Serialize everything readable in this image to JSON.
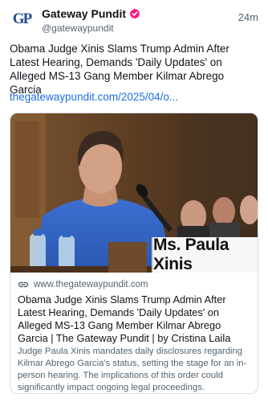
{
  "account": {
    "avatar_label": "GP",
    "display_name": "Gateway Pundit",
    "handle": "@gatewaypundit",
    "verified_icon": "verified-badge-icon",
    "verified_color": "#f91880"
  },
  "post": {
    "timestamp": "24m",
    "text": "Obama Judge Xinis Slams Trump Admin After Latest Hearing, Demands 'Daily Updates' on Alleged MS-13 Gang Member Kilmar Abrego Garcia",
    "link_text": "thegatewaypundit.com/2025/04/o...",
    "link_color": "#1d6fe0"
  },
  "card": {
    "image_placard_text": "Ms. Paula Xinis",
    "link_icon": "link-icon",
    "domain": "www.thegatewaypundit.com",
    "title": "Obama Judge Xinis Slams Trump Admin After Latest Hearing, Demands 'Daily Updates' on Alleged MS-13 Gang Member Kilmar Abrego Garcia | The Gateway Pundit | by Cristina Laila",
    "description": "Judge Paula Xinis mandates daily disclosures regarding Kilmar Abrego Garcia's status, setting the stage for an in-person hearing. The implications of this order could significantly impact ongoing legal proceedings."
  }
}
